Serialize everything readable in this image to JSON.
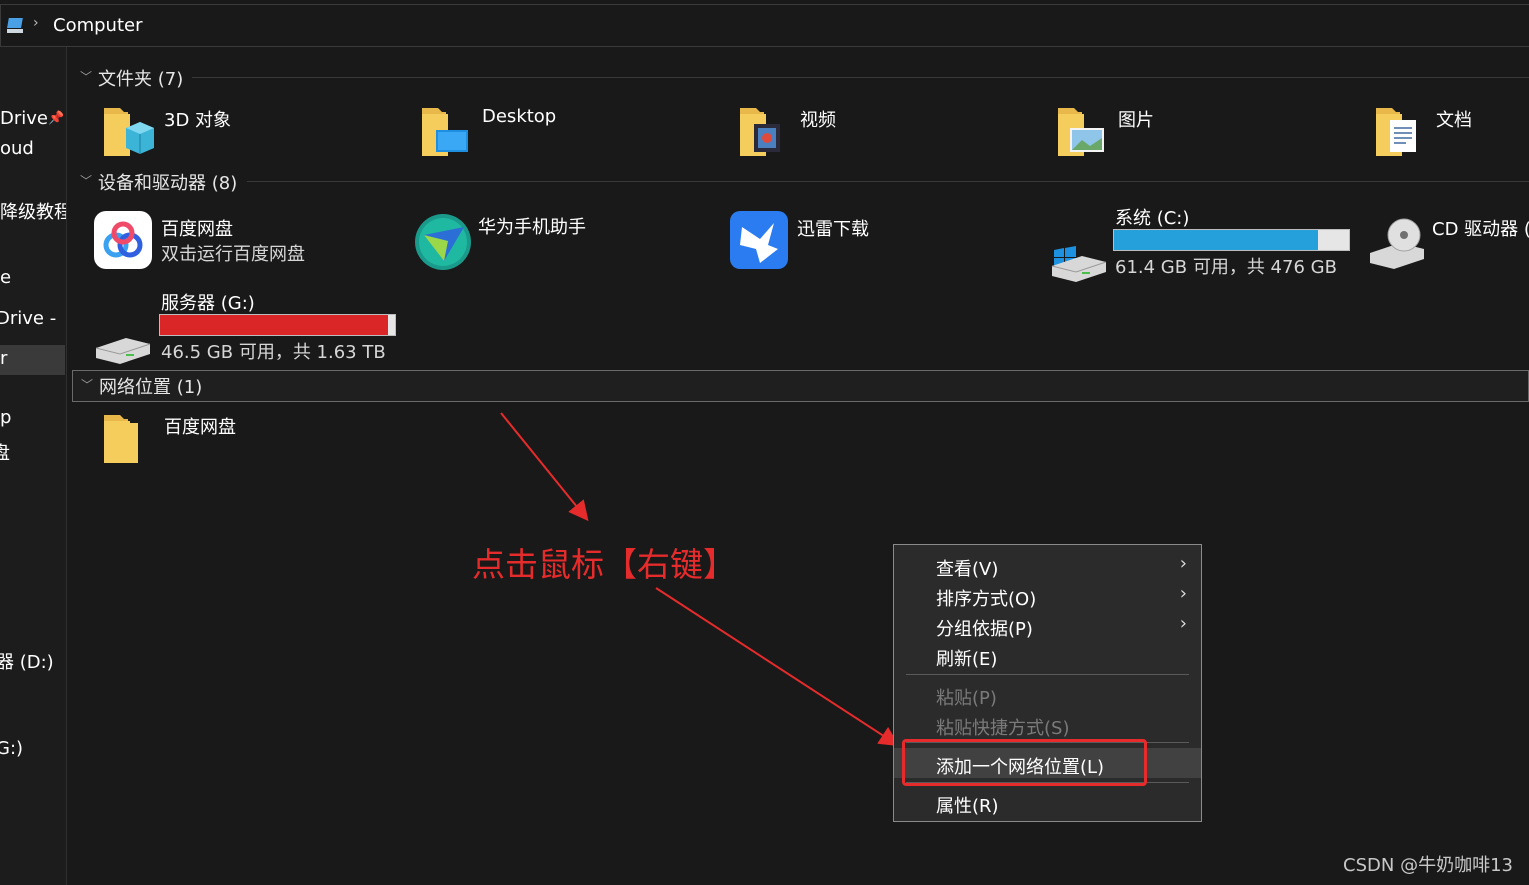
{
  "address": {
    "path": "Computer"
  },
  "sidebar": {
    "items": [
      "Drive",
      "oud",
      "降级教程",
      "e",
      "Drive -",
      "r",
      "p",
      "盘",
      "器 (D:)",
      "G:)"
    ]
  },
  "groups": {
    "folders": {
      "title": "文件夹 (7)",
      "items": [
        "3D 对象",
        "Desktop",
        "视频",
        "图片",
        "文档"
      ]
    },
    "devices": {
      "title": "设备和驱动器 (8)",
      "baidu": {
        "name": "百度网盘",
        "sub": "双击运行百度网盘"
      },
      "huawei": {
        "name": "华为手机助手"
      },
      "xunlei": {
        "name": "迅雷下载"
      },
      "system": {
        "name": "系统 (C:)",
        "sub": "61.4 GB 可用，共 476 GB",
        "used_fraction": 0.87,
        "bar_color": "#26a0da"
      },
      "cd": {
        "name": "CD 驱动器 ("
      },
      "server": {
        "name": "服务器 (G:)",
        "sub": "46.5 GB 可用，共 1.63 TB",
        "used_fraction": 0.97,
        "bar_color": "#da2626"
      }
    },
    "network": {
      "title": "网络位置 (1)",
      "items": [
        "百度网盘"
      ]
    }
  },
  "context_menu": {
    "view": "查看(V)",
    "sort": "排序方式(O)",
    "group": "分组依据(P)",
    "refresh": "刷新(E)",
    "paste": "粘贴(P)",
    "paste_shortcut": "粘贴快捷方式(S)",
    "add_network": "添加一个网络位置(L)",
    "properties": "属性(R)"
  },
  "annotation": {
    "text": "点击鼠标【右键】",
    "color": "#e52b2b"
  },
  "watermark": "CSDN @牛奶咖啡13"
}
